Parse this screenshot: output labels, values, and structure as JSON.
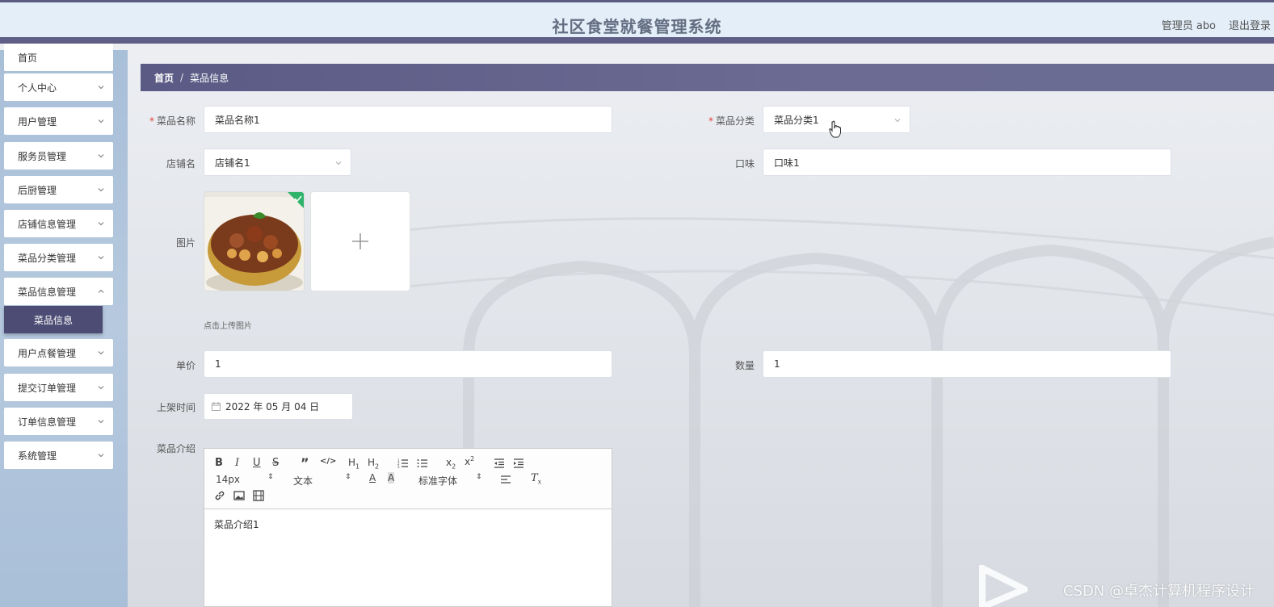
{
  "header": {
    "title": "社区食堂就餐管理系统",
    "user": "管理员 abo",
    "logout": "退出登录"
  },
  "sidebar": {
    "items": [
      {
        "label": "首页"
      },
      {
        "label": "个人中心"
      },
      {
        "label": "用户管理"
      },
      {
        "label": "服务员管理"
      },
      {
        "label": "后厨管理"
      },
      {
        "label": "店铺信息管理"
      },
      {
        "label": "菜品分类管理"
      },
      {
        "label": "菜品信息管理"
      },
      {
        "label": "用户点餐管理"
      },
      {
        "label": "提交订单管理"
      },
      {
        "label": "订单信息管理"
      },
      {
        "label": "系统管理"
      }
    ],
    "active_sub": "菜品信息"
  },
  "breadcrumb": {
    "home": "首页",
    "sep": "/",
    "current": "菜品信息"
  },
  "form": {
    "dish_name": {
      "label": "菜品名称",
      "value": "菜品名称1"
    },
    "category": {
      "label": "菜品分类",
      "value": "菜品分类1"
    },
    "shop": {
      "label": "店铺名",
      "value": "店铺名1"
    },
    "taste": {
      "label": "口味",
      "value": "口味1"
    },
    "image": {
      "label": "图片",
      "tip": "点击上传图片"
    },
    "price": {
      "label": "单价",
      "value": "1"
    },
    "quantity": {
      "label": "数量",
      "value": "1"
    },
    "time": {
      "label": "上架时间",
      "value": "2022 年 05 月 04 日"
    },
    "intro": {
      "label": "菜品介绍",
      "content": "菜品介绍1",
      "toolbar": {
        "size": "14px",
        "text": "文本",
        "font": "标准字体"
      }
    },
    "required_mark": "*"
  },
  "watermark": "CSDN @卓杰计算机程序设计",
  "colors": {
    "header_bg": "#e3eef8",
    "accent": "#5f5e86",
    "active_menu": "#4d4c74",
    "required": "#e2453c"
  }
}
